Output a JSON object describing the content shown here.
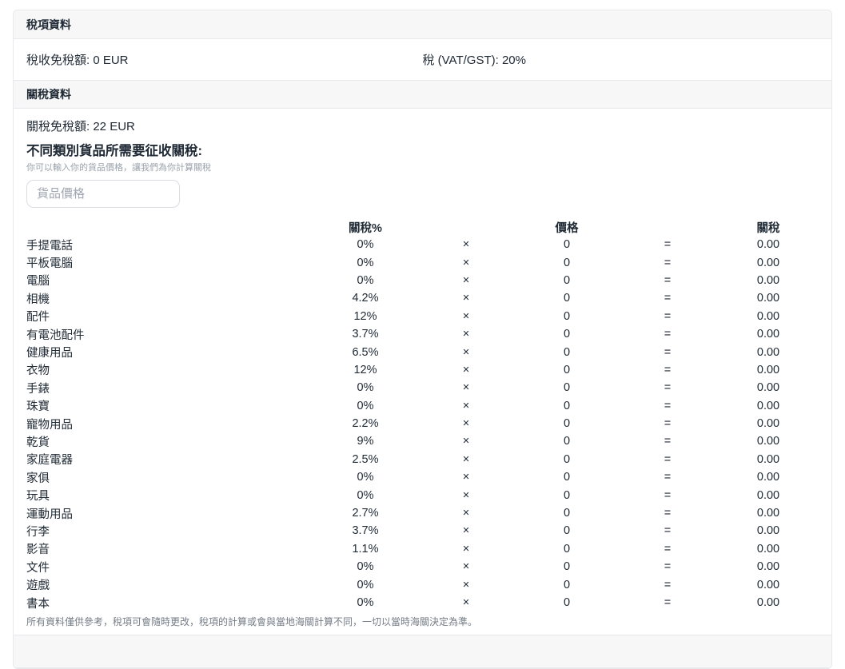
{
  "colors": {
    "text": "#212b36",
    "section_header_bg": "#f7f7f8",
    "border": "#e7e9ec",
    "hint_text": "#9aa2ab",
    "disclaimer_text": "#747c86",
    "input_border": "#d9dce1",
    "placeholder_text": "#9fa6b0"
  },
  "tax_section": {
    "header": "稅項資料",
    "tax_free_allowance": "稅收免稅額: 0 EUR",
    "vat_rate": "稅 (VAT/GST): 20%"
  },
  "duty_section": {
    "header": "關稅資料",
    "duty_free_allowance": "關稅免稅額: 22 EUR",
    "subtitle": "不同類別貨品所需要征收關稅:",
    "hint": "你可以輸入你的貨品價格，讓我們為你計算關稅",
    "price_input": {
      "placeholder": "貨品價格",
      "value": ""
    },
    "table": {
      "headers": {
        "rate": "關稅%",
        "price": "價格",
        "duty": "關稅"
      },
      "multiply_symbol": "×",
      "equals_symbol": "=",
      "rows": [
        {
          "category": "手提電話",
          "rate": "0%",
          "price": "0",
          "duty": "0.00"
        },
        {
          "category": "平板電腦",
          "rate": "0%",
          "price": "0",
          "duty": "0.00"
        },
        {
          "category": "電腦",
          "rate": "0%",
          "price": "0",
          "duty": "0.00"
        },
        {
          "category": "相機",
          "rate": "4.2%",
          "price": "0",
          "duty": "0.00"
        },
        {
          "category": "配件",
          "rate": "12%",
          "price": "0",
          "duty": "0.00"
        },
        {
          "category": "有電池配件",
          "rate": "3.7%",
          "price": "0",
          "duty": "0.00"
        },
        {
          "category": "健康用品",
          "rate": "6.5%",
          "price": "0",
          "duty": "0.00"
        },
        {
          "category": "衣物",
          "rate": "12%",
          "price": "0",
          "duty": "0.00"
        },
        {
          "category": "手錶",
          "rate": "0%",
          "price": "0",
          "duty": "0.00"
        },
        {
          "category": "珠寶",
          "rate": "0%",
          "price": "0",
          "duty": "0.00"
        },
        {
          "category": "寵物用品",
          "rate": "2.2%",
          "price": "0",
          "duty": "0.00"
        },
        {
          "category": "乾貨",
          "rate": "9%",
          "price": "0",
          "duty": "0.00"
        },
        {
          "category": "家庭電器",
          "rate": "2.5%",
          "price": "0",
          "duty": "0.00"
        },
        {
          "category": "家俱",
          "rate": "0%",
          "price": "0",
          "duty": "0.00"
        },
        {
          "category": "玩具",
          "rate": "0%",
          "price": "0",
          "duty": "0.00"
        },
        {
          "category": "運動用品",
          "rate": "2.7%",
          "price": "0",
          "duty": "0.00"
        },
        {
          "category": "行李",
          "rate": "3.7%",
          "price": "0",
          "duty": "0.00"
        },
        {
          "category": "影音",
          "rate": "1.1%",
          "price": "0",
          "duty": "0.00"
        },
        {
          "category": "文件",
          "rate": "0%",
          "price": "0",
          "duty": "0.00"
        },
        {
          "category": "遊戲",
          "rate": "0%",
          "price": "0",
          "duty": "0.00"
        },
        {
          "category": "書本",
          "rate": "0%",
          "price": "0",
          "duty": "0.00"
        }
      ]
    },
    "disclaimer": "所有資料僅供參考，稅項可會隨時更改，稅項的計算或會與當地海關計算不同，一切以當時海關決定為準。"
  }
}
